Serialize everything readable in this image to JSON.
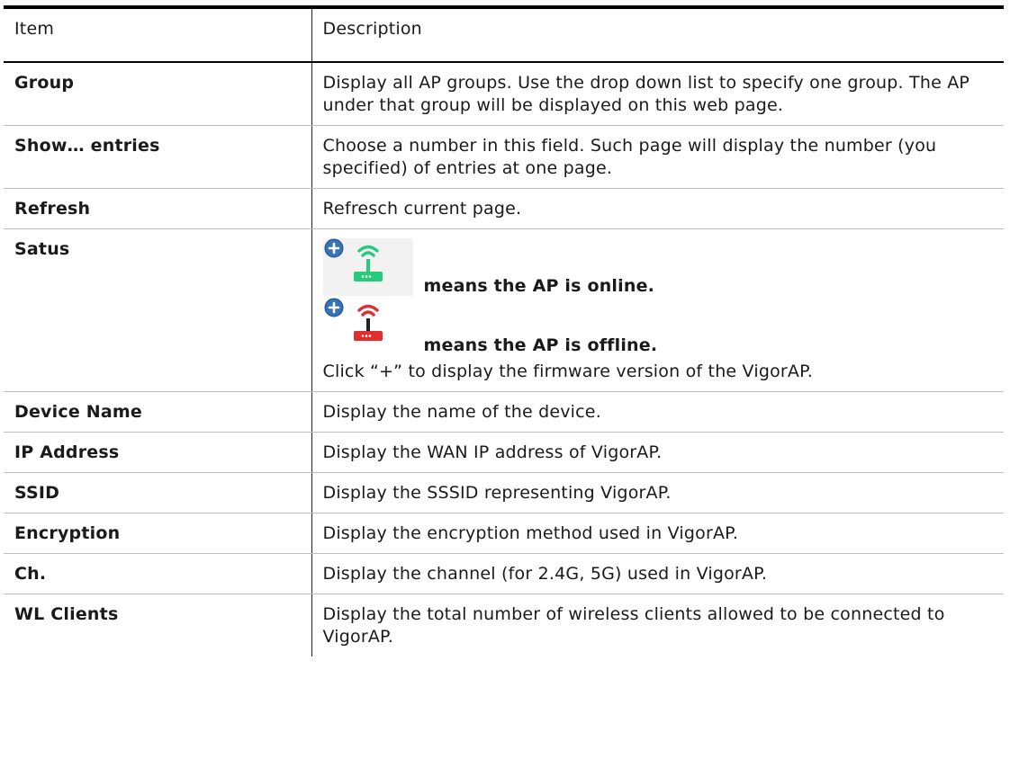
{
  "table": {
    "headers": [
      "Item",
      "Description"
    ],
    "rows": [
      {
        "item": "Group",
        "description": "Display all AP groups. Use the drop down list to specify one group. The AP under that group will be displayed on this web page."
      },
      {
        "item": "Show… entries",
        "description": "Choose a number in this field. Such page will display the number (you specified) of entries at one page."
      },
      {
        "item": "Refresh",
        "description": "Refresch current page."
      },
      {
        "item": "Satus",
        "status_online": "means the AP is online.",
        "status_offline": "means the AP is offline.",
        "description": "Click “+” to display the firmware version of the VigorAP."
      },
      {
        "item": "Device Name",
        "description": "Display the name of the device."
      },
      {
        "item": "IP Address",
        "description": "Display the WAN IP address of VigorAP."
      },
      {
        "item": "SSID",
        "description": "Display the SSSID representing VigorAP."
      },
      {
        "item": "Encryption",
        "description": "Display the encryption method used in VigorAP."
      },
      {
        "item": "Ch.",
        "description": "Display the channel (for 2.4G, 5G) used in VigorAP."
      },
      {
        "item": "WL Clients",
        "description": "Display the total number of wireless clients allowed to be connected to VigorAP."
      }
    ]
  },
  "icons": {
    "online": {
      "name": "ap-online-icon",
      "color": "#27c97a"
    },
    "offline": {
      "name": "ap-offline-icon",
      "color": "#e02d2d"
    },
    "plus": {
      "name": "plus-badge-icon",
      "color": "#3572b8"
    }
  }
}
